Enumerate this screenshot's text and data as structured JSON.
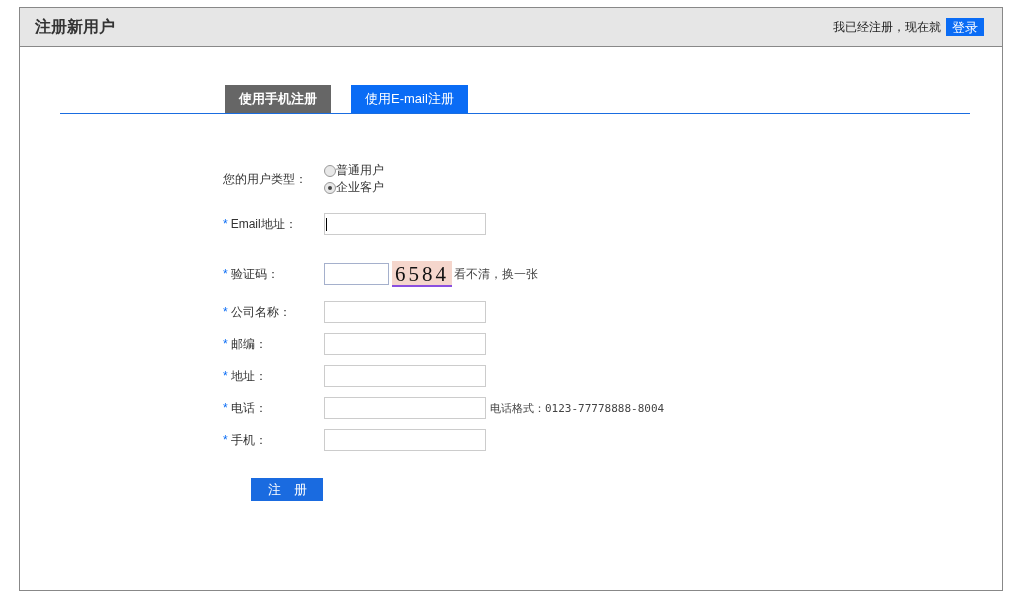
{
  "header": {
    "title": "注册新用户",
    "login_prompt": "我已经注册，现在就",
    "login_button": "登录"
  },
  "tabs": [
    {
      "label": "使用手机注册",
      "selected": false
    },
    {
      "label": "使用E-mail注册",
      "selected": true
    }
  ],
  "user_type": {
    "label": "您的用户类型：",
    "options": [
      {
        "label": "普通用户",
        "selected": false
      },
      {
        "label": "企业客户",
        "selected": true
      }
    ]
  },
  "fields": [
    {
      "kind": "text",
      "label": "Email地址：",
      "mark": "*",
      "focused": true
    },
    {
      "kind": "captcha",
      "label": "验证码：",
      "mark": "*",
      "captcha": "6584",
      "refresh_link": "看不清，换一张"
    },
    {
      "kind": "text",
      "label": "公司名称：",
      "mark": "*"
    },
    {
      "kind": "text",
      "label": "邮编：",
      "mark": "*"
    },
    {
      "kind": "text",
      "label": "地址：",
      "mark": "*"
    },
    {
      "kind": "text",
      "label": "电话：",
      "mark": "*",
      "hint": "电话格式：0123-77778888-8004"
    },
    {
      "kind": "text",
      "label": "手机：",
      "mark": "*"
    }
  ],
  "submit": "注　册"
}
